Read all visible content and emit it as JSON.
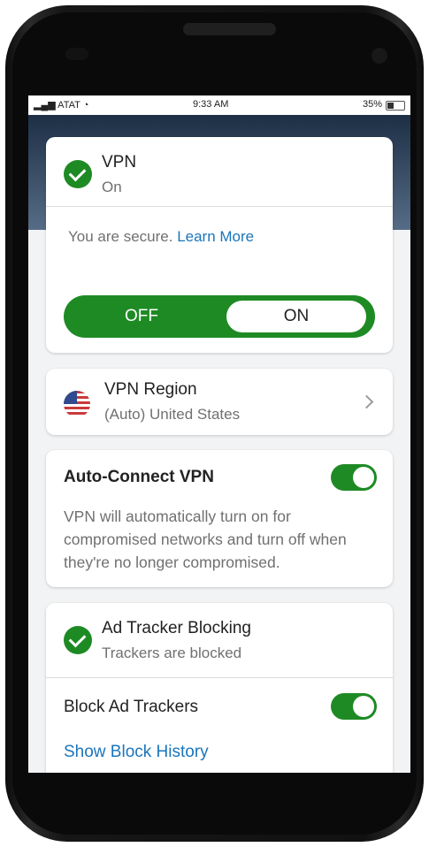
{
  "status_bar": {
    "carrier": "ATAT",
    "time": "9:33 AM",
    "battery": "35%"
  },
  "vpn_card": {
    "title": "VPN",
    "status": "On",
    "secure_text": "You are secure.",
    "learn_more": "Learn More",
    "switch_off_label": "OFF",
    "switch_on_label": "ON",
    "switch_state": "on"
  },
  "region_card": {
    "title": "VPN Region",
    "value": "(Auto) United States"
  },
  "auto_connect_card": {
    "title": "Auto-Connect VPN",
    "toggle_state": "on",
    "description": "VPN will automatically turn on for compromised networks and turn off when they're no longer compromised."
  },
  "ad_tracker_card": {
    "title": "Ad Tracker Blocking",
    "status": "Trackers are blocked",
    "block_label": "Block Ad Trackers",
    "toggle_state": "on",
    "history_link": "Show Block History"
  },
  "colors": {
    "accent_green": "#1e8a24",
    "link_blue": "#1b75bb",
    "header_navy": "#1d2f45"
  }
}
